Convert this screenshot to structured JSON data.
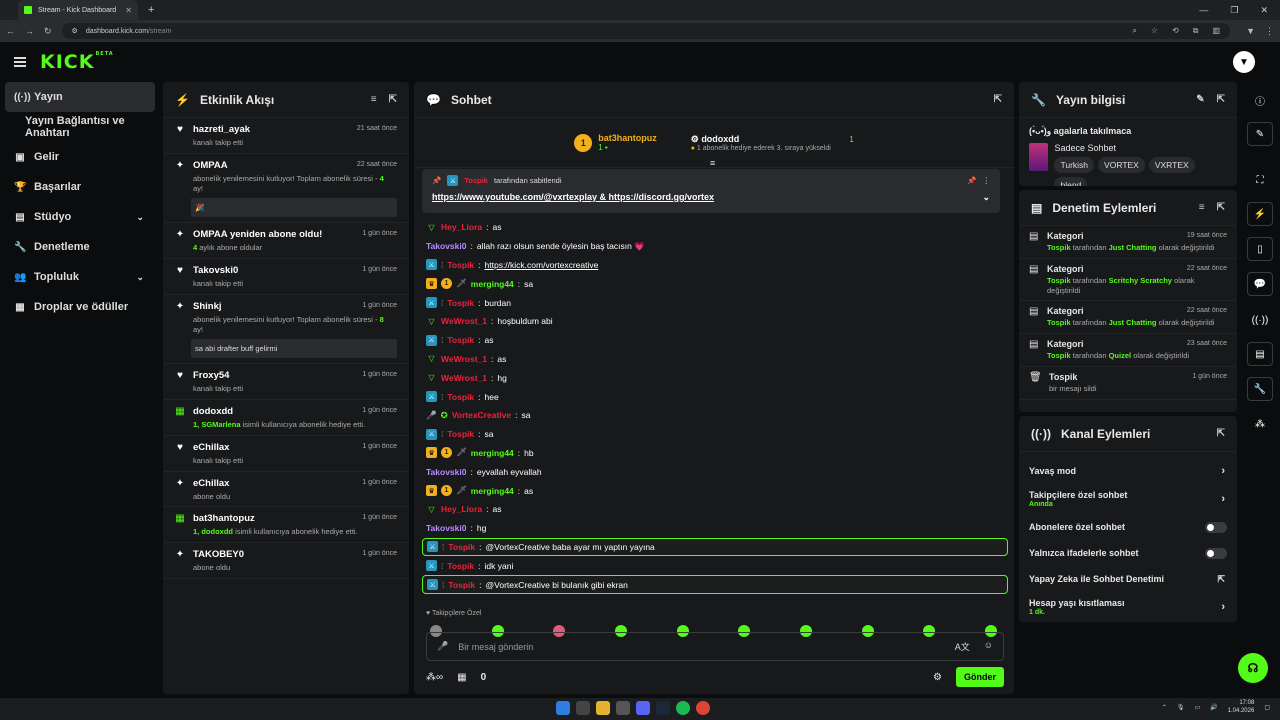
{
  "browser": {
    "tab_title": "Stream - Kick Dashboard",
    "url_host": "dashboard.kick.com",
    "url_path": "/stream"
  },
  "logo": {
    "text": "KICK",
    "beta": "BETA"
  },
  "sidebar": {
    "items": [
      {
        "label": "Yayın",
        "icon": "broadcast-icon"
      },
      {
        "label": "Yayın Bağlantısı ve Anahtarı",
        "icon": ""
      },
      {
        "label": "Gelir",
        "icon": "chart-icon"
      },
      {
        "label": "Başarılar",
        "icon": "trophy-icon"
      },
      {
        "label": "Stüdyo",
        "icon": "studio-icon"
      },
      {
        "label": "Denetleme",
        "icon": "wrench-icon"
      },
      {
        "label": "Topluluk",
        "icon": "people-icon"
      },
      {
        "label": "Droplar ve ödüller",
        "icon": "gift-icon"
      }
    ]
  },
  "activity": {
    "title": "Etkinlik Akışı",
    "items": [
      {
        "name": "hazreti_ayak",
        "time": "21 saat önce",
        "desc": "kanalı takip etti",
        "icon": "heart"
      },
      {
        "name": "OMPAA",
        "time": "22 saat önce",
        "desc": "abonelik yenilemesini kutluyor! Toplam abonelik süresi -",
        "num": "4",
        "desc2": "ay!",
        "msg": "🎉",
        "icon": "sub"
      },
      {
        "name": "OMPAA yeniden abone oldu!",
        "time": "1 gün önce",
        "num": "4",
        "desc": "aylık abone oldular",
        "icon": "sparkle"
      },
      {
        "name": "Takovski0",
        "time": "1 gün önce",
        "desc": "kanalı takip etti",
        "icon": "heart"
      },
      {
        "name": "Shinkj",
        "time": "1 gün önce",
        "desc": "abonelik yenilemesini kutluyor! Toplam abonelik süresi -",
        "num": "8",
        "desc2": "ay!",
        "msg": "sa abi drafter buff gelirmi",
        "icon": "sub"
      },
      {
        "name": "Froxy54",
        "time": "1 gün önce",
        "desc": "kanalı takip etti",
        "icon": "heart"
      },
      {
        "name": "dodoxdd",
        "time": "1 gün önce",
        "num": "1, SGMarlena",
        "desc": "isimli kullanıcıya abonelik hediye etti.",
        "icon": "gift"
      },
      {
        "name": "eChillax",
        "time": "1 gün önce",
        "desc": "kanalı takip etti",
        "icon": "heart"
      },
      {
        "name": "eChillax",
        "time": "1 gün önce",
        "desc": "abone oldu",
        "icon": "sparkle"
      },
      {
        "name": "bat3hantopuz",
        "time": "1 gün önce",
        "num": "1, dodoxdd",
        "desc": "isimli kullanıcıya abonelik hediye etti.",
        "icon": "gift"
      },
      {
        "name": "TAKOBEY0",
        "time": "1 gün önce",
        "desc": "abone oldu",
        "icon": "sparkle"
      }
    ]
  },
  "chat": {
    "title": "Sohbet",
    "top1": {
      "rank": "1",
      "name": "bat3hantopuz",
      "count": "1"
    },
    "top2": {
      "name": "dodoxdd",
      "count": "1",
      "sub": "1 abonelik hediye ederek 3. sıraya yükseldi"
    },
    "pinned": {
      "by": "Tospik",
      "by_text": "tarafından sabitlendi",
      "link1": "https://www.youtube.com/@vxrtexplay",
      "amp": "&",
      "link2": "https://discord.gg/vortex"
    },
    "messages": [
      {
        "user": "Hey_Liora",
        "color": "red",
        "badge": "vip",
        "text": "as"
      },
      {
        "user": "Takovski0",
        "color": "pur",
        "badge": "",
        "text": "allah razı olsun sende öylesin baş tacısın 💗"
      },
      {
        "user": "Tospik",
        "color": "red",
        "badge": "mod",
        "text": "https://kick.com/vortexcreative",
        "link": true
      },
      {
        "user": "merging44",
        "color": "grn",
        "badge": "og",
        "text": "sa"
      },
      {
        "user": "Tospik",
        "color": "red",
        "badge": "mod",
        "text": "burdan"
      },
      {
        "user": "WeWrost_1",
        "color": "red",
        "badge": "vip",
        "text": "hoşbuldum abi"
      },
      {
        "user": "Tospik",
        "color": "red",
        "badge": "mod",
        "text": "as"
      },
      {
        "user": "WeWrost_1",
        "color": "red",
        "badge": "vip",
        "text": "as"
      },
      {
        "user": "WeWrost_1",
        "color": "red",
        "badge": "vip",
        "text": "hg"
      },
      {
        "user": "Tospik",
        "color": "red",
        "badge": "mod",
        "text": "hee"
      },
      {
        "user": "VortexCreative",
        "color": "red",
        "badge": "host",
        "text": "sa"
      },
      {
        "user": "Tospik",
        "color": "red",
        "badge": "mod",
        "text": "sa"
      },
      {
        "user": "merging44",
        "color": "grn",
        "badge": "og",
        "text": "hb"
      },
      {
        "user": "Takovski0",
        "color": "pur",
        "badge": "",
        "text": "eyvallah eyvallah"
      },
      {
        "user": "merging44",
        "color": "grn",
        "badge": "og",
        "text": "as"
      },
      {
        "user": "Hey_Liora",
        "color": "red",
        "badge": "vip",
        "text": "as"
      },
      {
        "user": "Takovski0",
        "color": "pur",
        "badge": "",
        "text": "hg"
      },
      {
        "user": "Tospik",
        "color": "red",
        "badge": "mod",
        "text": "@VortexCreative baba ayar mı yaptın yayına",
        "hl": true
      },
      {
        "user": "Tospik",
        "color": "red",
        "badge": "mod",
        "text": "idk yani"
      },
      {
        "user": "Tospik",
        "color": "red",
        "badge": "mod",
        "text": "@VortexCreative bi bulanık gibi ekran",
        "hl": true
      }
    ],
    "emote_label": "Takipçilere Özel",
    "placeholder": "Bir mesaj gönderin",
    "footer_count": "0",
    "send": "Gönder"
  },
  "stream_info": {
    "title": "Yayın bilgisi",
    "stream_title": "(•̀ᴗ•́)و agalarla takılmaca",
    "category": "Sadece Sohbet",
    "tags": [
      "Turkish",
      "VORTEX",
      "VXRTEX",
      "blend"
    ]
  },
  "moderation": {
    "title": "Denetim Eylemleri",
    "items": [
      {
        "name": "Kategori",
        "time": "19 saat önce",
        "who": "Tospik",
        "mid": "tarafından",
        "what": "Just Chatting",
        "end": "olarak değiştirildi"
      },
      {
        "name": "Kategori",
        "time": "22 saat önce",
        "who": "Tospik",
        "mid": "tarafından",
        "what": "Scritchy Scratchy",
        "end": "olarak değiştirildi"
      },
      {
        "name": "Kategori",
        "time": "22 saat önce",
        "who": "Tospik",
        "mid": "tarafından",
        "what": "Just Chatting",
        "end": "olarak değiştirildi"
      },
      {
        "name": "Kategori",
        "time": "23 saat önce",
        "who": "Tospik",
        "mid": "tarafından",
        "what": "Quizel",
        "end": "olarak değiştirildi"
      },
      {
        "name": "Tospik",
        "time": "1 gün önce",
        "plain": "bir mesajı sildi"
      }
    ]
  },
  "channel": {
    "title": "Kanal Eylemleri",
    "items": [
      {
        "label": "Yavaş mod",
        "type": "arrow"
      },
      {
        "label": "Takipçilere özel sohbet",
        "sub": "Anında",
        "type": "arrow"
      },
      {
        "label": "Abonelere özel sohbet",
        "type": "toggle"
      },
      {
        "label": "Yalnızca ifadelerle sohbet",
        "type": "toggle"
      },
      {
        "label": "Yapay Zeka ile Sohbet Denetimi",
        "type": "ext"
      },
      {
        "label": "Hesap yaşı kısıtlaması",
        "sub": "1 dk.",
        "type": "arrow"
      }
    ]
  },
  "taskbar": {
    "time": "17:08",
    "date": "1.04.2026"
  }
}
